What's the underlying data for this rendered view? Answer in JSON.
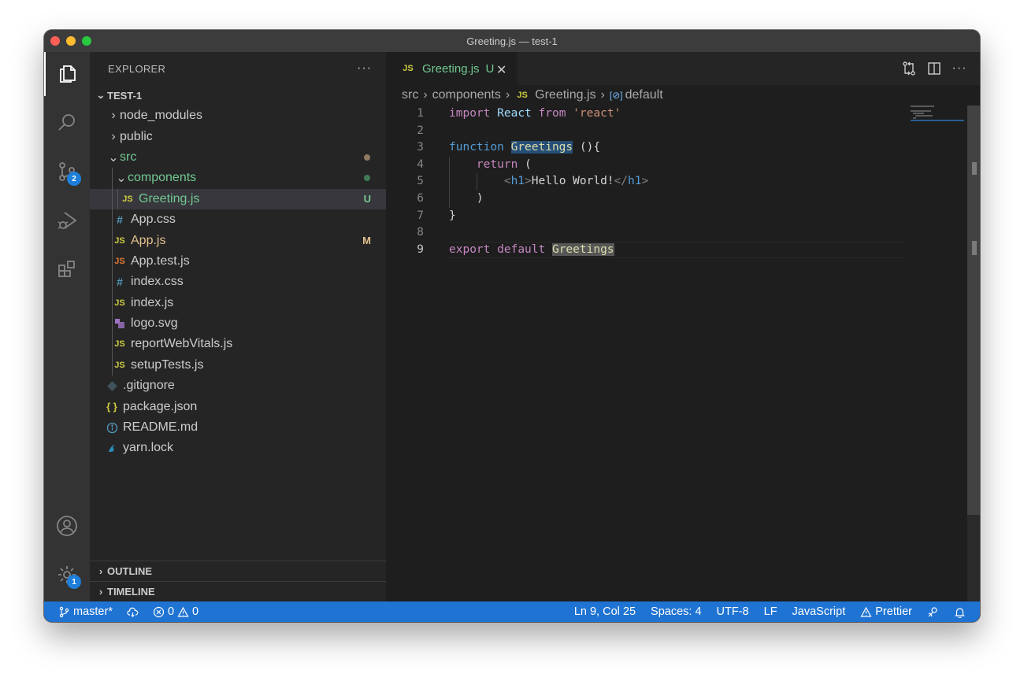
{
  "window": {
    "title": "Greeting.js — test-1"
  },
  "activity_bar": {
    "scm_badge": "2",
    "settings_badge": "1"
  },
  "sidebar": {
    "title": "EXPLORER",
    "more": "···",
    "folder": "TEST-1",
    "items": [
      {
        "label": "node_modules",
        "type": "folder",
        "expanded": false
      },
      {
        "label": "public",
        "type": "folder",
        "expanded": false
      },
      {
        "label": "src",
        "type": "folder",
        "expanded": true
      },
      {
        "label": "components",
        "type": "folder",
        "expanded": true
      },
      {
        "label": "Greeting.js",
        "icon": "JS",
        "decoration": "U"
      },
      {
        "label": "App.css",
        "icon": "#"
      },
      {
        "label": "App.js",
        "icon": "JS",
        "decoration": "M"
      },
      {
        "label": "App.test.js",
        "icon": "JS"
      },
      {
        "label": "index.css",
        "icon": "#"
      },
      {
        "label": "index.js",
        "icon": "JS"
      },
      {
        "label": "logo.svg",
        "icon": "svg-icon"
      },
      {
        "label": "reportWebVitals.js",
        "icon": "JS"
      },
      {
        "label": "setupTests.js",
        "icon": "JS"
      },
      {
        "label": ".gitignore",
        "icon": "git-icon"
      },
      {
        "label": "package.json",
        "icon": "{ }"
      },
      {
        "label": "README.md",
        "icon": "info-icon"
      },
      {
        "label": "yarn.lock",
        "icon": "yarn-icon"
      }
    ],
    "outline": "OUTLINE",
    "timeline": "TIMELINE"
  },
  "editor": {
    "tab": {
      "icon": "JS",
      "label": "Greeting.js",
      "status": "U"
    },
    "breadcrumb": [
      "src",
      "components",
      "Greeting.js",
      "default"
    ],
    "line_numbers": [
      "1",
      "2",
      "3",
      "4",
      "5",
      "6",
      "7",
      "8",
      "9"
    ],
    "code_tokens": {
      "import": "import",
      "React": "React",
      "from": "from",
      "react_str": "'react'",
      "function": "function",
      "Greetings": "Greetings",
      "paren_brace": " (){",
      "return": "return",
      "open_paren": " (",
      "lt": "<",
      "h1": "h1",
      "gt": ">",
      "text": "Hello World!",
      "lt_slash": "</",
      "close_paren": ")",
      "close_brace": "}",
      "export": "export",
      "default": "default"
    }
  },
  "status_bar": {
    "branch": "master*",
    "errors": "0",
    "warnings": "0",
    "position": "Ln 9, Col 25",
    "spaces": "Spaces: 4",
    "encoding": "UTF-8",
    "eol": "LF",
    "language": "JavaScript",
    "formatter": "Prettier"
  },
  "colors": {
    "status_bar": "#1f73d2",
    "untracked": "#73c991",
    "modified": "#e2c08d",
    "badge": "#1e7ed8"
  }
}
